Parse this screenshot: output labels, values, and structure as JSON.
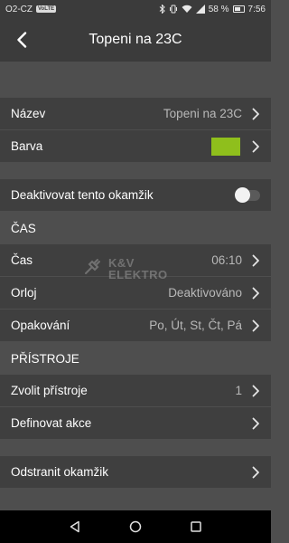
{
  "status_bar": {
    "carrier": "O2-CZ",
    "volte": "VoLTE",
    "battery": "58 %",
    "battery_level": 0.58,
    "time": "7:56",
    "icons": [
      "bluetooth-icon",
      "vibrate-icon",
      "wifi-icon",
      "signal-icon",
      "battery-icon"
    ]
  },
  "app_bar": {
    "title": "Topeni na 23C",
    "back_icon": "back-arrow-icon"
  },
  "basic": {
    "name_label": "Název",
    "name_value": "Topeni na 23C",
    "color_label": "Barva",
    "color_value": "#8fbf1c"
  },
  "deactivate": {
    "label": "Deaktivovat tento okamžik",
    "enabled": false
  },
  "time_section": {
    "header": "ČAS",
    "time_label": "Čas",
    "time_value": "06:10",
    "orloj_label": "Orloj",
    "orloj_value": "Deaktivováno",
    "repeat_label": "Opakování",
    "repeat_value": "Po, Út, St, Čt, Pá"
  },
  "devices_section": {
    "header": "PŘÍSTROJE",
    "select_label": "Zvolit přístroje",
    "select_value": "1",
    "actions_label": "Definovat akce"
  },
  "remove": {
    "label": "Odstranit okamžik"
  },
  "watermark": {
    "line1": "K&V",
    "line2": "ELEKTRO"
  },
  "nav_bar": {
    "icons": [
      "nav-back-icon",
      "nav-home-icon",
      "nav-recents-icon"
    ]
  },
  "colors": {
    "app_bar": "#3b3b3b",
    "row": "#3f3f3f",
    "background": "#4e4e4e",
    "accent_swatch": "#8fbf1c"
  }
}
